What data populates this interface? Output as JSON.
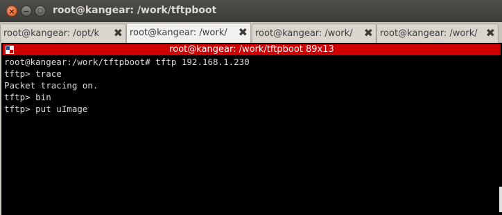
{
  "window": {
    "title": "root@kangear: /work/tftpboot",
    "close_glyph": "×",
    "minimize_glyph": "−",
    "maximize_glyph": "□"
  },
  "tabs": [
    {
      "label": "root@kangear: /opt/k",
      "active": false
    },
    {
      "label": "root@kangear: /work/",
      "active": true
    },
    {
      "label": "root@kangear: /work/",
      "active": false
    },
    {
      "label": "root@kangear: /work/",
      "active": false
    }
  ],
  "tab_close_glyph": "✖",
  "tab_scroll_glyph": "▶",
  "terminal": {
    "header": "root@kangear: /work/tftpboot 89x13",
    "lines": [
      "root@kangear:/work/tftpboot# tftp 192.168.1.230",
      "tftp> trace",
      "Packet tracing on.",
      "tftp> bin",
      "tftp> put uImage"
    ]
  },
  "colors": {
    "terminal_bg": "#000000",
    "terminal_fg": "#d9d9d9",
    "header_bg": "#cc0000",
    "close_button": "#e2541d"
  },
  "icons": [
    "close-icon",
    "minimize-icon",
    "maximize-icon",
    "tab-close-icon",
    "terminal-icon",
    "scroll-right-icon"
  ]
}
